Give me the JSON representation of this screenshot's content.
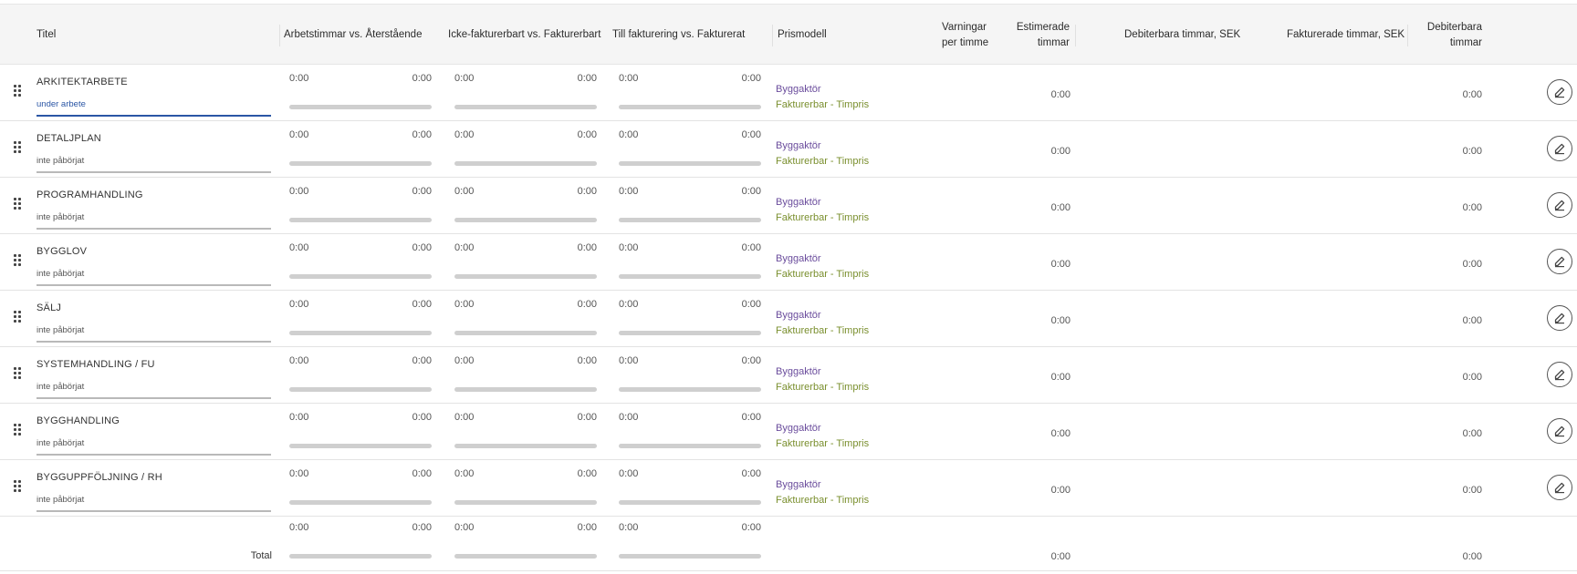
{
  "headers": {
    "title": "Titel",
    "work_vs_remaining": "Arbetstimmar vs. Återstående",
    "nonbill_vs_bill": "Icke-fakturerbart vs. Fakturerbart",
    "tobill_vs_billed": "Till fakturering vs. Fakturerat",
    "price_model": "Prismodell",
    "warnings_per_hour": "Varningar per timme",
    "estimated_hours": "Estimerade timmar",
    "billable_hours_sek": "Debiterbara timmar, SEK",
    "invoiced_hours_sek": "Fakturerade timmar, SEK",
    "billable_hours": "Debiterbara timmar"
  },
  "rows": [
    {
      "title": "ARKITEKTARBETE",
      "status": "under arbete",
      "active": true,
      "work": "0:00",
      "remaining": "0:00",
      "nonbill": "0:00",
      "bill": "0:00",
      "tobill": "0:00",
      "billed": "0:00",
      "pricemodel_client": "Byggaktör",
      "pricemodel_type": "Fakturerbar - Timpris",
      "estimated": "0:00",
      "billable": "0:00"
    },
    {
      "title": "DETALJPLAN",
      "status": "inte påbörjat",
      "active": false,
      "work": "0:00",
      "remaining": "0:00",
      "nonbill": "0:00",
      "bill": "0:00",
      "tobill": "0:00",
      "billed": "0:00",
      "pricemodel_client": "Byggaktör",
      "pricemodel_type": "Fakturerbar - Timpris",
      "estimated": "0:00",
      "billable": "0:00"
    },
    {
      "title": "PROGRAMHANDLING",
      "status": "inte påbörjat",
      "active": false,
      "work": "0:00",
      "remaining": "0:00",
      "nonbill": "0:00",
      "bill": "0:00",
      "tobill": "0:00",
      "billed": "0:00",
      "pricemodel_client": "Byggaktör",
      "pricemodel_type": "Fakturerbar - Timpris",
      "estimated": "0:00",
      "billable": "0:00"
    },
    {
      "title": "BYGGLOV",
      "status": "inte påbörjat",
      "active": false,
      "work": "0:00",
      "remaining": "0:00",
      "nonbill": "0:00",
      "bill": "0:00",
      "tobill": "0:00",
      "billed": "0:00",
      "pricemodel_client": "Byggaktör",
      "pricemodel_type": "Fakturerbar - Timpris",
      "estimated": "0:00",
      "billable": "0:00"
    },
    {
      "title": "SÄLJ",
      "status": "inte påbörjat",
      "active": false,
      "work": "0:00",
      "remaining": "0:00",
      "nonbill": "0:00",
      "bill": "0:00",
      "tobill": "0:00",
      "billed": "0:00",
      "pricemodel_client": "Byggaktör",
      "pricemodel_type": "Fakturerbar - Timpris",
      "estimated": "0:00",
      "billable": "0:00"
    },
    {
      "title": "SYSTEMHANDLING / FU",
      "status": "inte påbörjat",
      "active": false,
      "work": "0:00",
      "remaining": "0:00",
      "nonbill": "0:00",
      "bill": "0:00",
      "tobill": "0:00",
      "billed": "0:00",
      "pricemodel_client": "Byggaktör",
      "pricemodel_type": "Fakturerbar - Timpris",
      "estimated": "0:00",
      "billable": "0:00"
    },
    {
      "title": "BYGGHANDLING",
      "status": "inte påbörjat",
      "active": false,
      "work": "0:00",
      "remaining": "0:00",
      "nonbill": "0:00",
      "bill": "0:00",
      "tobill": "0:00",
      "billed": "0:00",
      "pricemodel_client": "Byggaktör",
      "pricemodel_type": "Fakturerbar - Timpris",
      "estimated": "0:00",
      "billable": "0:00"
    },
    {
      "title": "BYGGUPPFÖLJNING / RH",
      "status": "inte påbörjat",
      "active": false,
      "work": "0:00",
      "remaining": "0:00",
      "nonbill": "0:00",
      "bill": "0:00",
      "tobill": "0:00",
      "billed": "0:00",
      "pricemodel_client": "Byggaktör",
      "pricemodel_type": "Fakturerbar - Timpris",
      "estimated": "0:00",
      "billable": "0:00"
    }
  ],
  "total": {
    "label": "Total",
    "work": "0:00",
    "remaining": "0:00",
    "nonbill": "0:00",
    "bill": "0:00",
    "tobill": "0:00",
    "billed": "0:00",
    "estimated": "0:00",
    "billable": "0:00"
  },
  "icons": {
    "drag": "drag-handle-icon",
    "edit": "pencil-icon"
  },
  "colors": {
    "active": "#2b56a5",
    "client": "#6a4c9c",
    "pricetype": "#7a8f2e"
  }
}
